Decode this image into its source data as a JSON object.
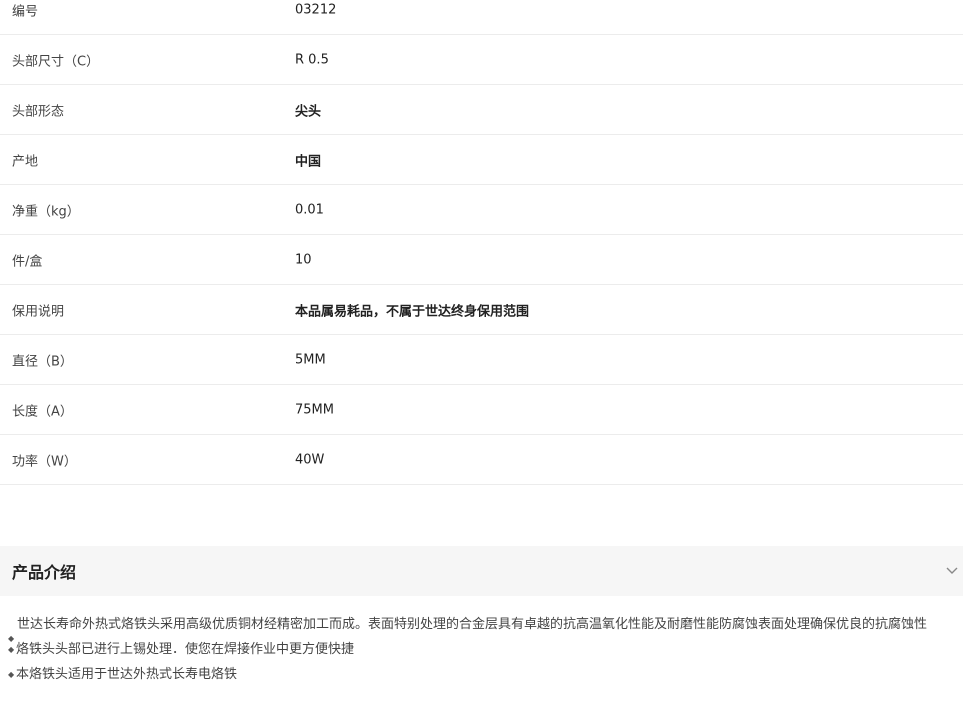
{
  "specs": [
    {
      "label": "编号",
      "value": "03212",
      "bold": false
    },
    {
      "label": "头部尺寸（C）",
      "value": "R 0.5",
      "bold": false
    },
    {
      "label": "头部形态",
      "value": "尖头",
      "bold": true
    },
    {
      "label": "产地",
      "value": "中国",
      "bold": true
    },
    {
      "label": "净重（kg）",
      "value": "0.01",
      "bold": false
    },
    {
      "label": "件/盒",
      "value": "10",
      "bold": false
    },
    {
      "label": "保用说明",
      "value": "本品属易耗品，不属于世达终身保用范围",
      "bold": true
    },
    {
      "label": "直径（B）",
      "value": "5MM",
      "bold": false
    },
    {
      "label": "长度（A）",
      "value": "75MM",
      "bold": false
    },
    {
      "label": "功率（W）",
      "value": "40W",
      "bold": false
    }
  ],
  "section": {
    "title": "产品介绍",
    "bullet": "◆"
  },
  "intro": [
    "世达长寿命外热式烙铁头采用高级优质铜材经精密加工而成。表面特别处理的合金层具有卓越的抗高温氧化性能及耐磨性能防腐蚀表面处理确保优良的抗腐蚀性",
    "烙铁头头部已进行上锡处理．使您在焊接作业中更方便快捷",
    "本烙铁头适用于世达外热式长寿电烙铁"
  ]
}
